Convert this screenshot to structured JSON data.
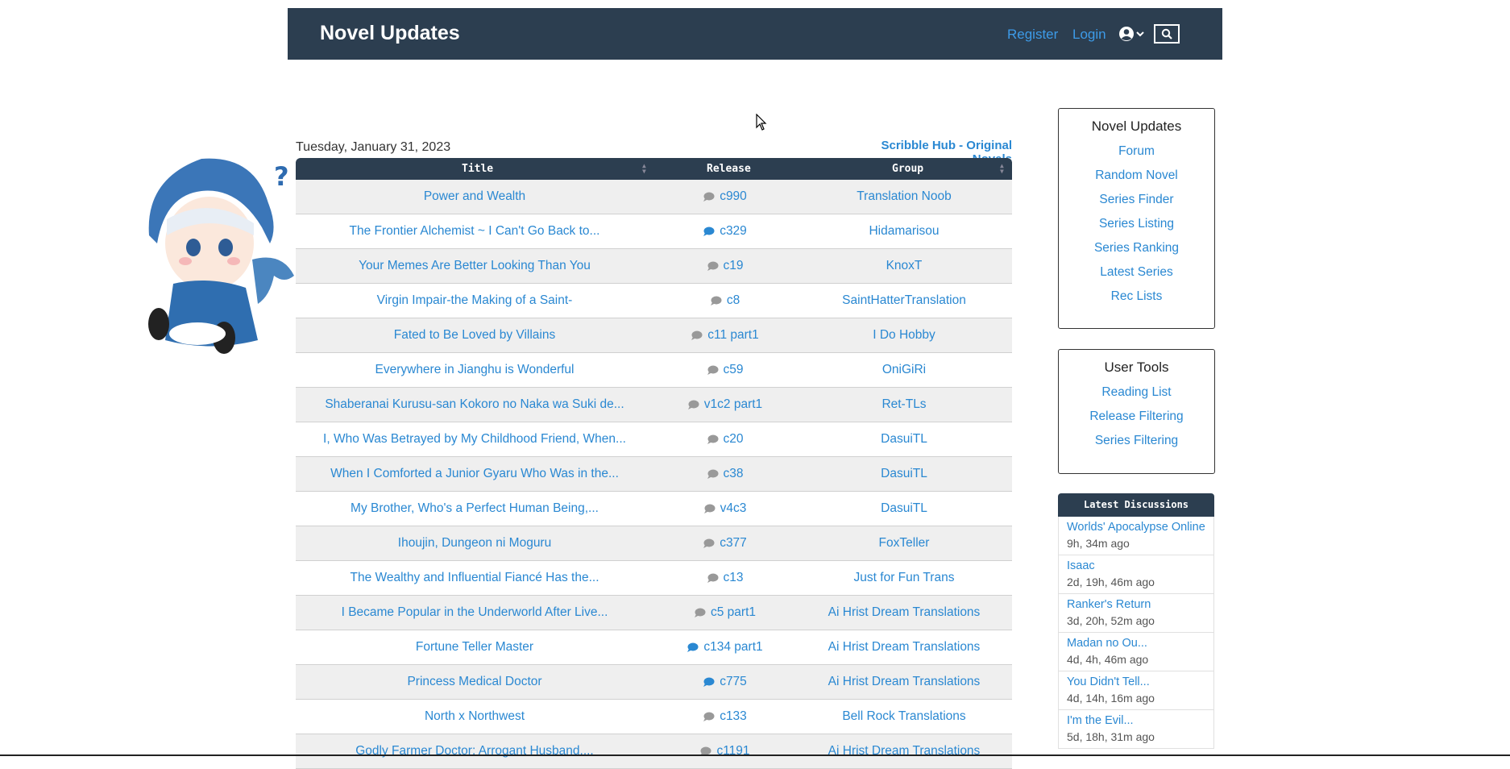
{
  "header": {
    "brand": "Novel Updates",
    "register": "Register",
    "login": "Login"
  },
  "main": {
    "date": "Tuesday, January 31, 2023",
    "scribble_link": "Scribble Hub - Original Novels",
    "columns": {
      "title": "Title",
      "release": "Release",
      "group": "Group"
    },
    "rows": [
      {
        "title": "Power and Wealth",
        "release": "c990",
        "group": "Translation Noob",
        "bubble": "gray"
      },
      {
        "title": "The Frontier Alchemist ~ I Can't Go Back to...",
        "release": "c329",
        "group": "Hidamarisou",
        "bubble": "blue"
      },
      {
        "title": "Your Memes Are Better Looking Than You",
        "release": "c19",
        "group": "KnoxT",
        "bubble": "gray"
      },
      {
        "title": "Virgin Impair-the Making of a Saint-",
        "release": "c8",
        "group": "SaintHatterTranslation",
        "bubble": "gray"
      },
      {
        "title": "Fated to Be Loved by Villains",
        "release": "c11 part1",
        "group": "I Do Hobby",
        "bubble": "gray"
      },
      {
        "title": "Everywhere in Jianghu is Wonderful",
        "release": "c59",
        "group": "OniGiRi",
        "bubble": "gray"
      },
      {
        "title": "Shaberanai Kurusu-san Kokoro no Naka wa Suki de...",
        "release": "v1c2 part1",
        "group": "Ret-TLs",
        "bubble": "gray"
      },
      {
        "title": "I, Who Was Betrayed by My Childhood Friend, When...",
        "release": "c20",
        "group": "DasuiTL",
        "bubble": "gray"
      },
      {
        "title": "When I Comforted a Junior Gyaru Who Was in the...",
        "release": "c38",
        "group": "DasuiTL",
        "bubble": "gray"
      },
      {
        "title": "My Brother, Who's a Perfect Human Being,...",
        "release": "v4c3",
        "group": "DasuiTL",
        "bubble": "gray"
      },
      {
        "title": "Ihoujin, Dungeon ni Moguru",
        "release": "c377",
        "group": "FoxTeller",
        "bubble": "gray"
      },
      {
        "title": "The Wealthy and Influential Fiancé Has the...",
        "release": "c13",
        "group": "Just for Fun Trans",
        "bubble": "gray"
      },
      {
        "title": "I Became Popular in the Underworld After Live...",
        "release": "c5 part1",
        "group": "Ai Hrist Dream Translations",
        "bubble": "gray"
      },
      {
        "title": "Fortune Teller Master",
        "release": "c134 part1",
        "group": "Ai Hrist Dream Translations",
        "bubble": "blue"
      },
      {
        "title": "Princess Medical Doctor",
        "release": "c775",
        "group": "Ai Hrist Dream Translations",
        "bubble": "blue"
      },
      {
        "title": "North x Northwest",
        "release": "c133",
        "group": "Bell Rock Translations",
        "bubble": "gray"
      },
      {
        "title": "Godly Farmer Doctor: Arrogant Husband,...",
        "release": "c1191",
        "group": "Ai Hrist Dream Translations",
        "bubble": "gray"
      }
    ]
  },
  "sidebar": {
    "nu_box": {
      "title": "Novel Updates",
      "links": [
        "Forum",
        "Random Novel",
        "Series Finder",
        "Series Listing",
        "Series Ranking",
        "Latest Series",
        "Rec Lists"
      ]
    },
    "tools_box": {
      "title": "User Tools",
      "links": [
        "Reading List",
        "Release Filtering",
        "Series Filtering"
      ]
    },
    "discussions": {
      "title": "Latest Discussions",
      "items": [
        {
          "title": "Worlds' Apocalypse Online",
          "time": "9h, 34m ago"
        },
        {
          "title": "Isaac",
          "time": "2d, 19h, 46m ago"
        },
        {
          "title": "Ranker's Return",
          "time": "3d, 20h, 52m ago"
        },
        {
          "title": "Madan no Ou...",
          "time": "4d, 4h, 46m ago"
        },
        {
          "title": "You Didn't Tell...",
          "time": "4d, 14h, 16m ago"
        },
        {
          "title": "I'm the Evil...",
          "time": "5d, 18h, 31m ago"
        }
      ]
    }
  },
  "colors": {
    "navbar": "#2c3e50",
    "link": "#2a88d2",
    "row_alt": "#efefef"
  },
  "icons": {
    "user": "user-circle-icon",
    "search": "search-icon",
    "comment": "comment-icon"
  }
}
